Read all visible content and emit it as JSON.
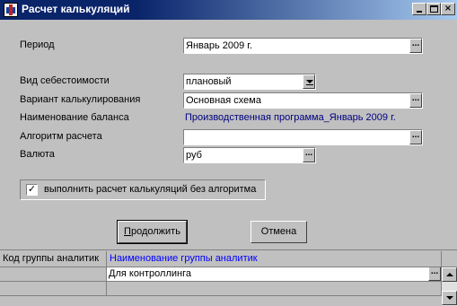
{
  "window": {
    "title": "Расчет калькуляций",
    "min_glyph": "_",
    "close_glyph": "×"
  },
  "form": {
    "period": {
      "label": "Период",
      "value": "Январь 2009 г."
    },
    "cost_type": {
      "label": "Вид себестоимости",
      "value": "плановый"
    },
    "calc_variant": {
      "label": "Вариант калькулирования",
      "value": "Основная схема"
    },
    "balance_name": {
      "label": "Наименование баланса",
      "value": "Производственная программа_Январь 2009 г."
    },
    "algorithm": {
      "label": "Алгоритм расчета",
      "value": ""
    },
    "currency": {
      "label": "Валюта",
      "value": "руб"
    },
    "ellipsis": "...",
    "no_algorithm": {
      "label": "выполнить расчет калькуляций без алгоритма",
      "checked": true,
      "mark": "✓"
    }
  },
  "buttons": {
    "continue": {
      "prefix": "",
      "underlined": "П",
      "rest": "родолжить"
    },
    "cancel": "Отмена"
  },
  "grid": {
    "columns": [
      "Код группы аналитик",
      "Наименование группы аналитик"
    ],
    "rows": [
      {
        "code": "",
        "name": "Для контроллинга"
      }
    ],
    "ellipsis": "..."
  },
  "colors": {
    "title_bar": "#0a246a",
    "link_text": "#00007f",
    "header_accent": "#0000ff",
    "background": "#c0c0c0"
  }
}
